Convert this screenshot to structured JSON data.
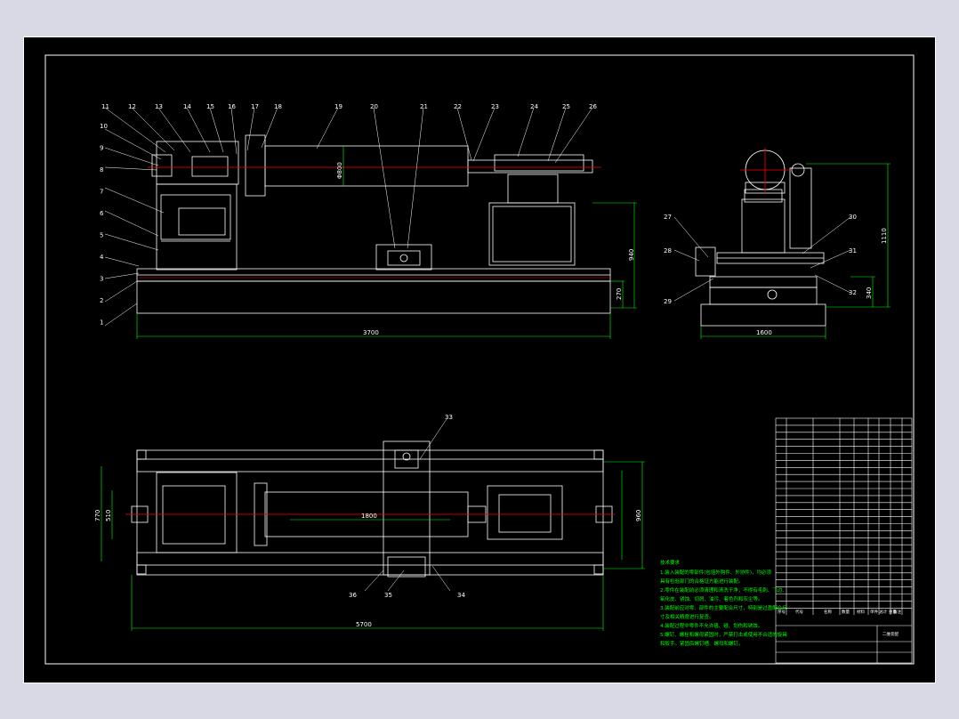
{
  "colors": {
    "background": "#000000",
    "outline": "#ffffff",
    "centerline": "#ff0000",
    "dimension": "#00ff00",
    "hatch": "#00ffff",
    "chrome": "#d9d9e6"
  },
  "front_view": {
    "part_labels": [
      "11",
      "12",
      "13",
      "14",
      "15",
      "16",
      "17",
      "18",
      "19",
      "20",
      "21",
      "22",
      "23",
      "24",
      "25",
      "26",
      "10",
      "9",
      "8",
      "7",
      "6",
      "5",
      "4",
      "3",
      "2",
      "1"
    ],
    "dimensions": {
      "overall_length": "3700",
      "roll_diameter": "Φ800",
      "height_total": "940",
      "base_height": "270"
    }
  },
  "side_view": {
    "part_labels": [
      "27",
      "28",
      "29",
      "30",
      "31",
      "32"
    ],
    "dimensions": {
      "width": "1600",
      "height_total": "1110",
      "base_height": "340"
    }
  },
  "top_view": {
    "part_labels": [
      "33",
      "34",
      "35",
      "36"
    ],
    "dimensions": {
      "overall_length": "5700",
      "width_outer": "770",
      "width_inner": "510",
      "right_width": "960",
      "roll_length": "1800"
    }
  },
  "notes": {
    "title": "技术要求",
    "lines": [
      "1.装入装配的零部件(包括外购件、外协件)，均必须",
      "具有检验部门的合格证方能进行装配。",
      "2.零件在装配前必须清理和清洗干净，不得有毛刺、飞边、",
      "氧化皮、锈蚀、切屑、油污、着色剂和灰尘等。",
      "3.装配前应对零、部件的主要配合尺寸，特别是过盈配合尺",
      "寸及相关精度进行复查。",
      "4.装配过程中零件不允许磕、碰、划伤和锈蚀。",
      "5.螺钉、螺栓和螺母紧固时，严禁打击或使用不合适的旋具",
      "和扳手。紧固后螺钉槽、螺母和螺钉。"
    ]
  },
  "title_block": {
    "header_cells": [
      "序号",
      "代号",
      "名称",
      "数量",
      "材料",
      "单件 总计 重量",
      "备注"
    ],
    "drawing_name": "二维装配",
    "row_count": 28
  }
}
